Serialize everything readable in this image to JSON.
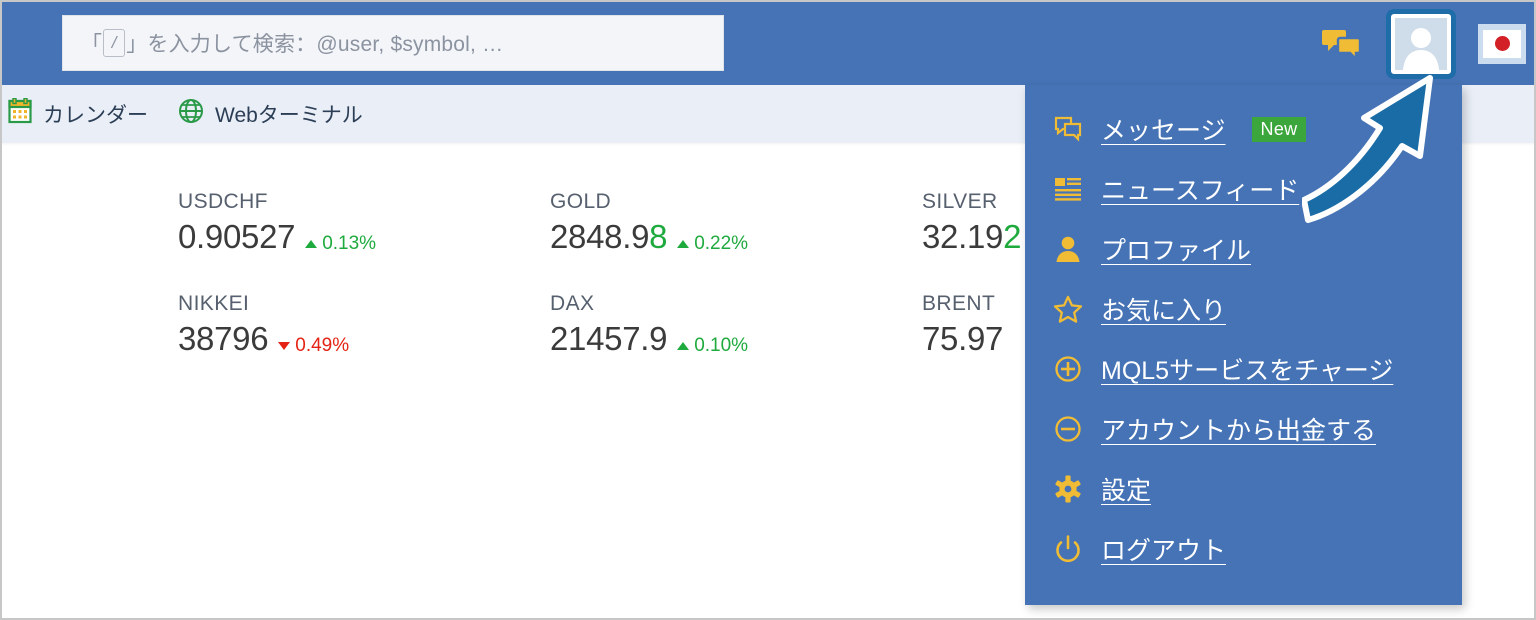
{
  "header": {
    "background_color": "#4573b5",
    "search": {
      "placeholder_prefix": "「",
      "placeholder_key": "/",
      "placeholder_suffix": "」を入力して検索：@user, $symbol, …",
      "value": ""
    },
    "chat_icon": "chat-bubbles-icon",
    "avatar_icon": "user-avatar-icon",
    "flag_icon": "japan-flag-icon"
  },
  "toolbar": {
    "items": [
      {
        "icon": "calendar-icon",
        "label": "カレンダー"
      },
      {
        "icon": "globe-icon",
        "label": "Webターミナル"
      }
    ]
  },
  "quotes": {
    "rows": [
      [
        {
          "symbol": "USDCHF",
          "price_head": "0.90527",
          "price_tick": "",
          "change": "0.13%",
          "direction": "up"
        },
        {
          "symbol": "GOLD",
          "price_head": "2848.9",
          "price_tick": "8",
          "change": "0.22%",
          "direction": "up"
        },
        {
          "symbol": "SILVER",
          "price_head": "32.19",
          "price_tick": "2",
          "change": "",
          "direction": "up"
        }
      ],
      [
        {
          "symbol": "NIKKEI",
          "price_head": "38796",
          "price_tick": "",
          "change": "0.49%",
          "direction": "down"
        },
        {
          "symbol": "DAX",
          "price_head": "21457.9",
          "price_tick": "",
          "change": "0.10%",
          "direction": "up"
        },
        {
          "symbol": "BRENT",
          "price_head": "75.97",
          "price_tick": "",
          "change": "",
          "direction": "up"
        }
      ]
    ],
    "colors": {
      "up": "#1faa3e",
      "down": "#e52314"
    }
  },
  "dropdown": {
    "background_color": "#4573b5",
    "items": [
      {
        "icon": "message-icon",
        "label": "メッセージ",
        "badge": "New"
      },
      {
        "icon": "news-feed-icon",
        "label": "ニュースフィード",
        "badge": ""
      },
      {
        "icon": "profile-icon",
        "label": "プロファイル",
        "badge": ""
      },
      {
        "icon": "star-icon",
        "label": "お気に入り",
        "badge": ""
      },
      {
        "icon": "plus-circle-icon",
        "label": "MQL5サービスをチャージ",
        "badge": ""
      },
      {
        "icon": "minus-circle-icon",
        "label": "アカウントから出金する",
        "badge": ""
      },
      {
        "icon": "gear-icon",
        "label": "設定",
        "badge": ""
      },
      {
        "icon": "power-icon",
        "label": "ログアウト",
        "badge": ""
      }
    ],
    "badge_color": "#3aa63c"
  },
  "annotation": {
    "type": "curved-arrow",
    "points_to": "avatar-button",
    "color": "#1e6ca8",
    "outline_color": "#ffffff"
  }
}
